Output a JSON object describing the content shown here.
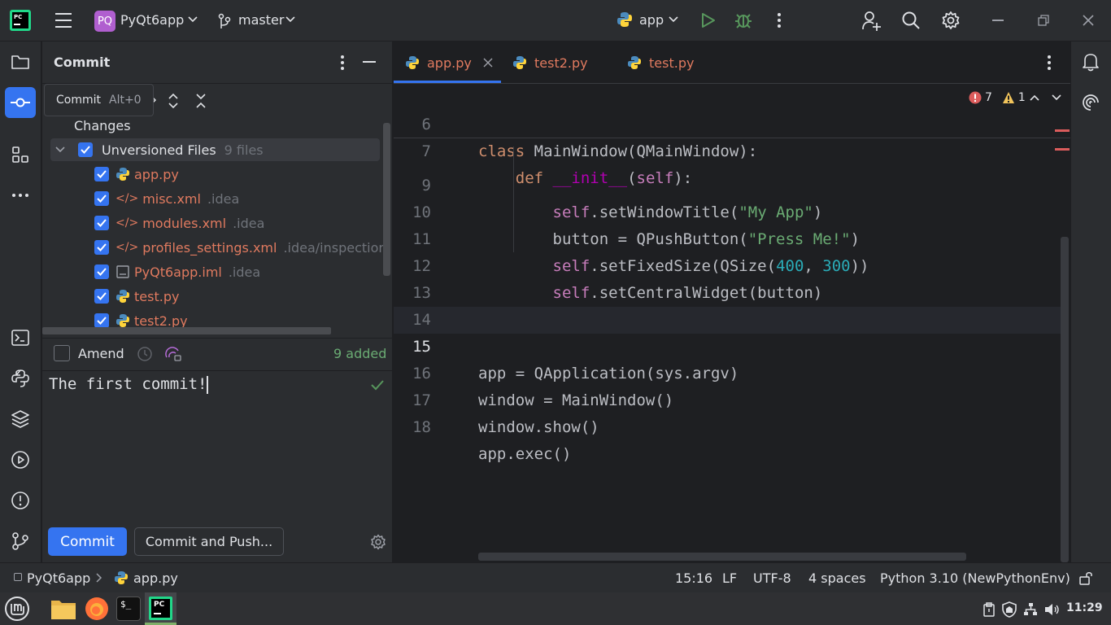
{
  "titlebar": {
    "project_badge": "PQ",
    "project_name": "PyQt6app",
    "branch": "master",
    "run_config": "app"
  },
  "tooltip": {
    "label": "Commit",
    "shortcut": "Alt+0"
  },
  "commit_panel": {
    "title": "Commit",
    "changes_label": "Changes",
    "group": {
      "label": "Unversioned Files",
      "count": "9 files"
    },
    "files": [
      {
        "name": "app.py",
        "path": "",
        "type": "python"
      },
      {
        "name": "misc.xml",
        "path": ".idea",
        "type": "xml"
      },
      {
        "name": "modules.xml",
        "path": ".idea",
        "type": "xml"
      },
      {
        "name": "profiles_settings.xml",
        "path": ".idea/inspectionPro",
        "type": "xml"
      },
      {
        "name": "PyQt6app.iml",
        "path": ".idea",
        "type": "iml"
      },
      {
        "name": "test.py",
        "path": "",
        "type": "python"
      },
      {
        "name": "test2.py",
        "path": "",
        "type": "python"
      }
    ],
    "amend_label": "Amend",
    "added_count": "9 added",
    "message": "The first commit!",
    "commit_button": "Commit",
    "commit_push_button": "Commit and Push..."
  },
  "editor": {
    "tabs": [
      {
        "label": "app.py",
        "active": true
      },
      {
        "label": "test2.py",
        "active": false
      },
      {
        "label": "test.py",
        "active": false
      }
    ],
    "error_count": "7",
    "warning_count": "1",
    "sticky": [
      {
        "line": "6",
        "code": "class MainWindow(QMainWindow):"
      },
      {
        "line": "7",
        "code": "    def __init__(self):"
      }
    ],
    "lines": [
      {
        "line": "9",
        "code": "        self.setWindowTitle(\"My App\")"
      },
      {
        "line": "10",
        "code": "        button = QPushButton(\"Press Me!\")"
      },
      {
        "line": "11",
        "code": "        self.setFixedSize(QSize(400, 300))"
      },
      {
        "line": "12",
        "code": "        self.setCentralWidget(button)"
      },
      {
        "line": "13",
        "code": ""
      },
      {
        "line": "14",
        "code": ""
      },
      {
        "line": "15",
        "code": "app = QApplication(sys.argv)"
      },
      {
        "line": "16",
        "code": "window = MainWindow()"
      },
      {
        "line": "17",
        "code": "window.show()"
      },
      {
        "line": "18",
        "code": "app.exec()"
      }
    ]
  },
  "statusbar": {
    "breadcrumb_project": "PyQt6app",
    "breadcrumb_file": "app.py",
    "position": "15:16",
    "line_sep": "LF",
    "encoding": "UTF-8",
    "indent": "4 spaces",
    "interpreter": "Python 3.10 (NewPythonEnv)"
  },
  "taskbar": {
    "clock": "11:29"
  },
  "colors": {
    "accent": "#3574f0",
    "background": "#1e1f22",
    "panel": "#2b2d30"
  }
}
